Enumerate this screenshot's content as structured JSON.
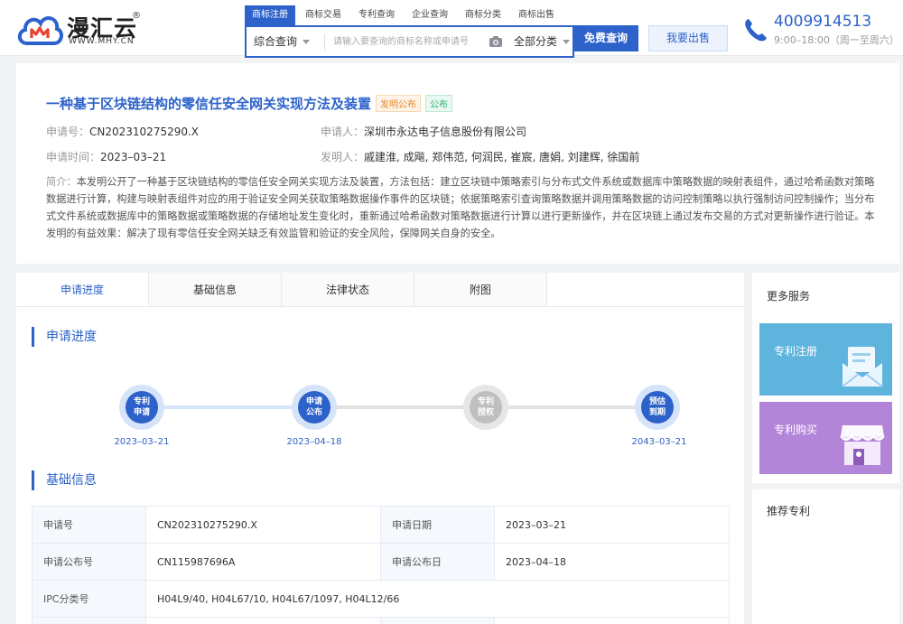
{
  "brand": {
    "name": "漫汇云",
    "domain": "WWW.MHY.CN",
    "reg_mark": "®"
  },
  "top_tabs": [
    {
      "label": "商标注册",
      "active": true
    },
    {
      "label": "商标交易",
      "active": false
    },
    {
      "label": "专利查询",
      "active": false
    },
    {
      "label": "企业查询",
      "active": false
    },
    {
      "label": "商标分类",
      "active": false
    },
    {
      "label": "商标出售",
      "active": false
    }
  ],
  "search": {
    "scope": "综合查询",
    "placeholder": "请输入要查询的商标名称或申请号",
    "category": "全部分类",
    "button": "免费查询"
  },
  "sell_button": "我要出售",
  "contact": {
    "phone": "4009914513",
    "hours": "9:00–18:00（周一至周六）"
  },
  "patent": {
    "title": "一种基于区块链结构的零信任安全网关实现方法及装置",
    "badges": [
      "发明公布",
      "公布"
    ],
    "app_no_label": "申请号：",
    "app_no": "CN202310275290.X",
    "applicant_label": "申请人：",
    "applicant": "深圳市永达电子信息股份有限公司",
    "app_date_label": "申请时间：",
    "app_date": "2023–03–21",
    "inventor_label": "发明人：",
    "inventors": "戚建淮, 成飚, 郑伟范, 何润民, 崔宸, 唐娟, 刘建辉, 徐国前",
    "abstract_label": "简介：",
    "abstract": "本发明公开了一种基于区块链结构的零信任安全网关实现方法及装置，方法包括：建立区块链中策略索引与分布式文件系统或数据库中策略数据的映射表组件，通过哈希函数对策略数据进行计算，构建与映射表组件对应的用于验证安全网关获取策略数据操作事件的区块链；依据策略索引查询策略数据并调用策略数据的访问控制策略以执行强制访问控制操作；当分布式文件系统或数据库中的策略数据或策略数据的存储地址发生变化时，重新通过哈希函数对策略数据进行计算以进行更新操作，并在区块链上通过发布交易的方式对更新操作进行验证。本发明的有益效果：解决了现有零信任安全网关缺乏有效监管和验证的安全风险，保障网关自身的安全。"
  },
  "tabs": [
    "申请进度",
    "基础信息",
    "法律状态",
    "附图"
  ],
  "progress": {
    "title": "申请进度",
    "nodes": [
      {
        "label": "专利申请",
        "date": "2023–03–21",
        "state": "done"
      },
      {
        "label": "申请公布",
        "date": "2023–04–18",
        "state": "done"
      },
      {
        "label": "专利授权",
        "date": "",
        "state": "pending"
      },
      {
        "label": "预估到期",
        "date": "2043–03–21",
        "state": "done"
      }
    ]
  },
  "basic": {
    "title": "基础信息",
    "rows": [
      {
        "k1": "申请号",
        "v1": "CN202310275290.X",
        "k2": "申请日期",
        "v2": "2023–03–21"
      },
      {
        "k1": "申请公布号",
        "v1": "CN115987696A",
        "k2": "申请公布日",
        "v2": "2023–04–18"
      },
      {
        "k1": "IPC分类号",
        "v1": "H04L9/40, H04L67/10, H04L67/1097, H04L12/66"
      }
    ]
  },
  "sidebar": {
    "more_title": "更多服务",
    "cards": [
      {
        "label": "专利注册",
        "color": "#5fb4de"
      },
      {
        "label": "专利购买",
        "color": "#b385d9"
      }
    ],
    "recommend_title": "推荐专利"
  },
  "colors": {
    "accent": "#2c62c9",
    "pending": "#bfbfbf"
  }
}
